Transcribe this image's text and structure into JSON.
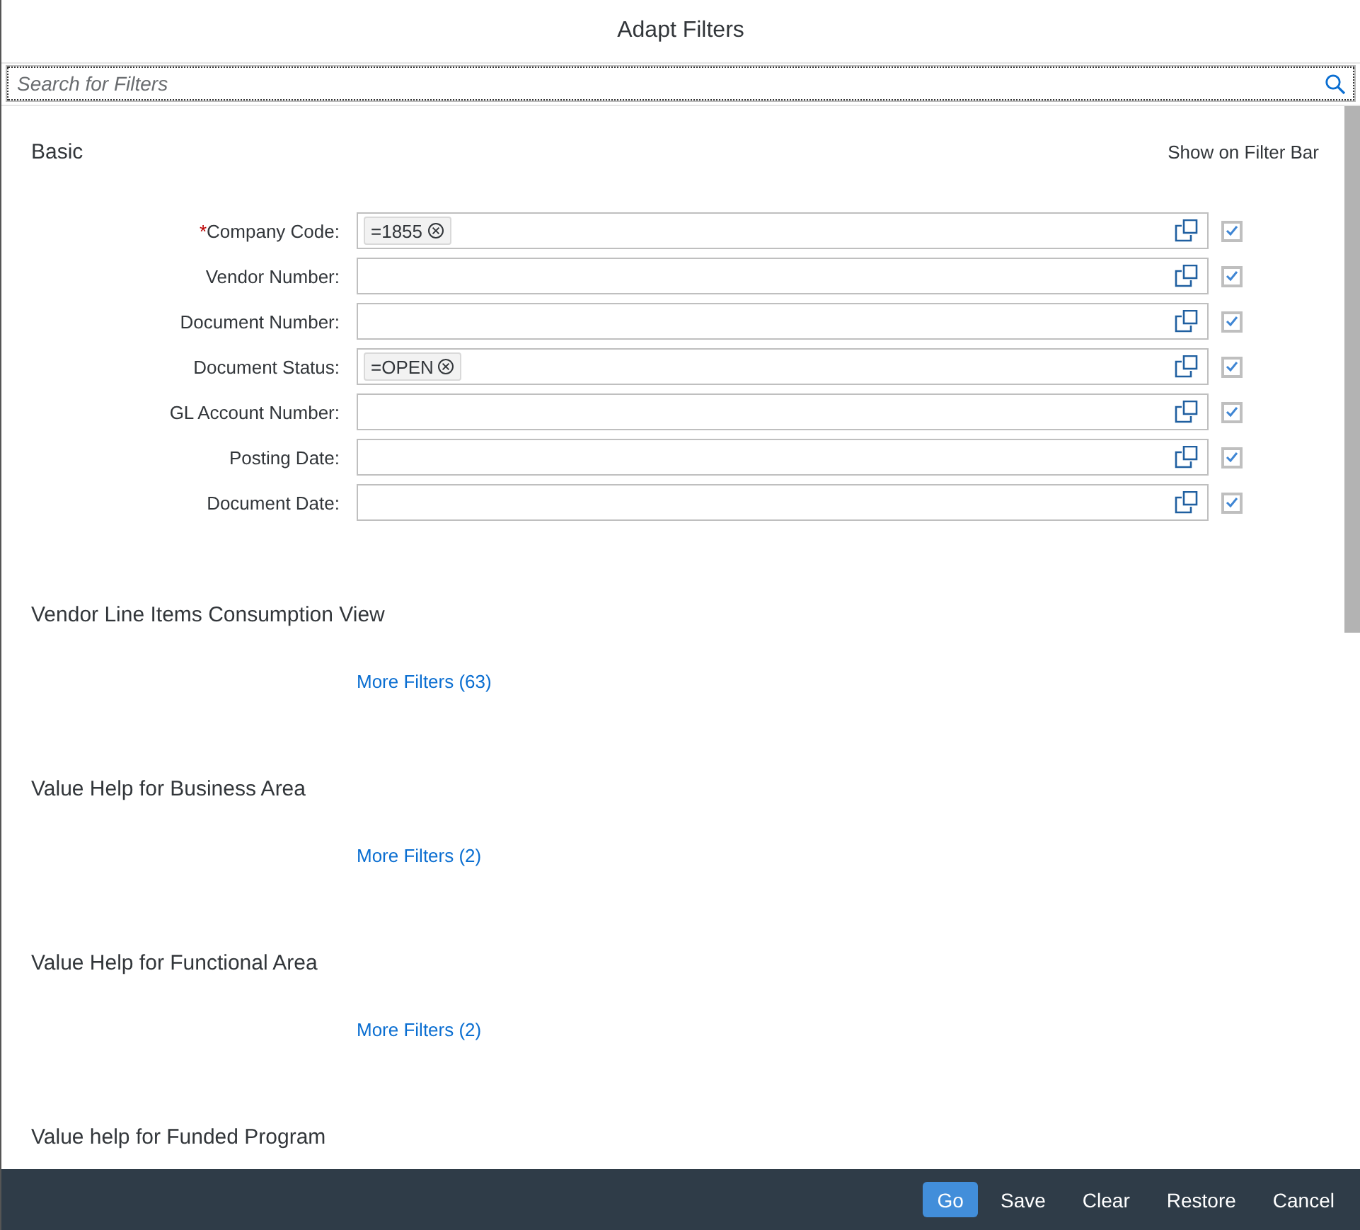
{
  "dialog": {
    "title": "Adapt Filters"
  },
  "search": {
    "placeholder": "Search for Filters"
  },
  "required_marker": "*",
  "basic": {
    "title": "Basic",
    "column_header": "Show on Filter Bar",
    "fields": [
      {
        "label": "Company Code:",
        "required": true,
        "tokens": [
          "=1855"
        ],
        "show_on_bar": true
      },
      {
        "label": "Vendor Number:",
        "required": false,
        "show_on_bar": true
      },
      {
        "label": "Document Number:",
        "required": false,
        "show_on_bar": true
      },
      {
        "label": "Document Status:",
        "required": false,
        "tokens": [
          "=OPEN"
        ],
        "show_on_bar": true
      },
      {
        "label": "GL Account Number:",
        "required": false,
        "show_on_bar": true
      },
      {
        "label": "Posting Date:",
        "required": false,
        "show_on_bar": true
      },
      {
        "label": "Document Date:",
        "required": false,
        "show_on_bar": true
      }
    ]
  },
  "groups": [
    {
      "title": "Vendor Line Items Consumption View",
      "more_filters": "More Filters (63)"
    },
    {
      "title": "Value Help for Business Area",
      "more_filters": "More Filters (2)"
    },
    {
      "title": "Value Help for Functional Area",
      "more_filters": "More Filters (2)"
    },
    {
      "title": "Value help for Funded Program"
    }
  ],
  "buttons": [
    {
      "label": "Go",
      "emphasized": true
    },
    {
      "label": "Save",
      "emphasized": false
    },
    {
      "label": "Clear",
      "emphasized": false
    },
    {
      "label": "Restore",
      "emphasized": false
    },
    {
      "label": "Cancel",
      "emphasized": false
    }
  ]
}
